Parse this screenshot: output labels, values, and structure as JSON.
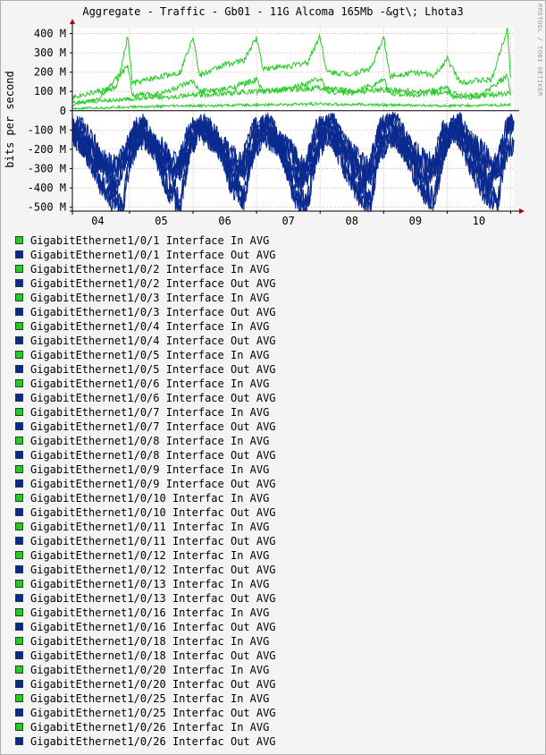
{
  "chart_data": {
    "type": "line",
    "title": "Aggregate - Traffic - Gb01 - 11G Alcoma 165Mb -&gt\\; Lhota3",
    "ylabel": "bits per second",
    "xlabel": "",
    "watermark": "RRDTOOL / TOBI OETIKER",
    "y_ticks": [
      "400 M",
      "300 M",
      "200 M",
      "100 M",
      "0",
      "-100 M",
      "-200 M",
      "-300 M",
      "-400 M",
      "-500 M"
    ],
    "y_tick_values": [
      400,
      300,
      200,
      100,
      0,
      -100,
      -200,
      -300,
      -400,
      -500
    ],
    "ylim": [
      -520,
      430
    ],
    "x_ticks": [
      "04",
      "05",
      "06",
      "07",
      "08",
      "09",
      "10"
    ],
    "x_range_days": [
      3.6,
      10.55
    ],
    "grid": true,
    "colors": {
      "in": "#22cc22",
      "out": "#0b2a8f",
      "axis": "#000000",
      "grid": "#e08080",
      "arrow": "#aa0000"
    },
    "series": [
      {
        "name": "GigabitEthernet1/0/1 Interface In AVG",
        "kind": "in"
      },
      {
        "name": "GigabitEthernet1/0/1 Interface Out AVG",
        "kind": "out"
      },
      {
        "name": "GigabitEthernet1/0/2 Interface In AVG",
        "kind": "in"
      },
      {
        "name": "GigabitEthernet1/0/2 Interface Out AVG",
        "kind": "out"
      },
      {
        "name": "GigabitEthernet1/0/3 Interface In AVG",
        "kind": "in"
      },
      {
        "name": "GigabitEthernet1/0/3 Interface Out AVG",
        "kind": "out"
      },
      {
        "name": "GigabitEthernet1/0/4 Interface In AVG",
        "kind": "in"
      },
      {
        "name": "GigabitEthernet1/0/4 Interface Out AVG",
        "kind": "out"
      },
      {
        "name": "GigabitEthernet1/0/5 Interface In AVG",
        "kind": "in"
      },
      {
        "name": "GigabitEthernet1/0/5 Interface Out AVG",
        "kind": "out"
      },
      {
        "name": "GigabitEthernet1/0/6 Interface In AVG",
        "kind": "in"
      },
      {
        "name": "GigabitEthernet1/0/6 Interface Out AVG",
        "kind": "out"
      },
      {
        "name": "GigabitEthernet1/0/7 Interface In AVG",
        "kind": "in"
      },
      {
        "name": "GigabitEthernet1/0/7 Interface Out AVG",
        "kind": "out"
      },
      {
        "name": "GigabitEthernet1/0/8 Interface In AVG",
        "kind": "in"
      },
      {
        "name": "GigabitEthernet1/0/8 Interface Out AVG",
        "kind": "out"
      },
      {
        "name": "GigabitEthernet1/0/9 Interface In AVG",
        "kind": "in"
      },
      {
        "name": "GigabitEthernet1/0/9 Interface Out AVG",
        "kind": "out"
      },
      {
        "name": "GigabitEthernet1/0/10 Interfac In AVG",
        "kind": "in"
      },
      {
        "name": "GigabitEthernet1/0/10 Interfac Out AVG",
        "kind": "out"
      },
      {
        "name": "GigabitEthernet1/0/11 Interfac In AVG",
        "kind": "in"
      },
      {
        "name": "GigabitEthernet1/0/11 Interfac Out AVG",
        "kind": "out"
      },
      {
        "name": "GigabitEthernet1/0/12 Interfac In AVG",
        "kind": "in"
      },
      {
        "name": "GigabitEthernet1/0/12 Interfac Out AVG",
        "kind": "out"
      },
      {
        "name": "GigabitEthernet1/0/13 Interfac In AVG",
        "kind": "in"
      },
      {
        "name": "GigabitEthernet1/0/13 Interfac Out AVG",
        "kind": "out"
      },
      {
        "name": "GigabitEthernet1/0/16 Interfac In AVG",
        "kind": "in"
      },
      {
        "name": "GigabitEthernet1/0/16 Interfac Out AVG",
        "kind": "out"
      },
      {
        "name": "GigabitEthernet1/0/18 Interfac In AVG",
        "kind": "in"
      },
      {
        "name": "GigabitEthernet1/0/18 Interfac Out AVG",
        "kind": "out"
      },
      {
        "name": "GigabitEthernet1/0/20 Interfac In AVG",
        "kind": "in"
      },
      {
        "name": "GigabitEthernet1/0/20 Interfac Out AVG",
        "kind": "out"
      },
      {
        "name": "GigabitEthernet1/0/25 Interfac In AVG",
        "kind": "in"
      },
      {
        "name": "GigabitEthernet1/0/25 Interfac Out AVG",
        "kind": "out"
      },
      {
        "name": "GigabitEthernet1/0/26 Interfac In AVG",
        "kind": "in"
      },
      {
        "name": "GigabitEthernet1/0/26 Interfac Out AVG",
        "kind": "out"
      }
    ],
    "traces": {
      "in": [
        [
          [
            3.6,
            70
          ],
          [
            4.0,
            100
          ],
          [
            4.3,
            120
          ],
          [
            4.47,
            380
          ],
          [
            4.55,
            140
          ],
          [
            4.9,
            170
          ],
          [
            5.3,
            200
          ],
          [
            5.5,
            390
          ],
          [
            5.6,
            180
          ],
          [
            6.0,
            240
          ],
          [
            6.3,
            260
          ],
          [
            6.5,
            380
          ],
          [
            6.6,
            220
          ],
          [
            7.0,
            230
          ],
          [
            7.3,
            250
          ],
          [
            7.5,
            390
          ],
          [
            7.6,
            200
          ],
          [
            8.0,
            190
          ],
          [
            8.3,
            220
          ],
          [
            8.5,
            380
          ],
          [
            8.6,
            180
          ],
          [
            9.0,
            200
          ],
          [
            9.3,
            180
          ],
          [
            9.5,
            270
          ],
          [
            9.7,
            150
          ],
          [
            10.2,
            160
          ],
          [
            10.45,
            430
          ],
          [
            10.5,
            170
          ]
        ],
        [
          [
            3.6,
            30
          ],
          [
            4.0,
            60
          ],
          [
            4.47,
            230
          ],
          [
            4.55,
            80
          ],
          [
            5.0,
            90
          ],
          [
            5.5,
            150
          ],
          [
            5.6,
            100
          ],
          [
            6.0,
            110
          ],
          [
            6.5,
            160
          ],
          [
            6.6,
            100
          ],
          [
            7.0,
            110
          ],
          [
            7.5,
            170
          ],
          [
            7.6,
            100
          ],
          [
            8.0,
            90
          ],
          [
            8.5,
            160
          ],
          [
            8.6,
            90
          ],
          [
            9.0,
            80
          ],
          [
            9.5,
            120
          ],
          [
            9.6,
            70
          ],
          [
            10.0,
            70
          ],
          [
            10.45,
            180
          ],
          [
            10.5,
            80
          ]
        ],
        [
          [
            3.6,
            40
          ],
          [
            4.0,
            50
          ],
          [
            4.5,
            60
          ],
          [
            5.0,
            70
          ],
          [
            5.5,
            80
          ],
          [
            6.0,
            90
          ],
          [
            6.5,
            100
          ],
          [
            7.0,
            110
          ],
          [
            7.5,
            120
          ],
          [
            8.0,
            100
          ],
          [
            8.5,
            110
          ],
          [
            9.0,
            100
          ],
          [
            9.5,
            90
          ],
          [
            10.0,
            80
          ],
          [
            10.5,
            90
          ]
        ],
        [
          [
            3.6,
            10
          ],
          [
            4.5,
            20
          ],
          [
            5.5,
            25
          ],
          [
            6.5,
            30
          ],
          [
            7.5,
            35
          ],
          [
            8.5,
            30
          ],
          [
            9.5,
            25
          ],
          [
            10.5,
            30
          ]
        ]
      ],
      "out": [
        [
          [
            3.6,
            -100
          ],
          [
            3.8,
            -200
          ],
          [
            4.0,
            -350
          ],
          [
            4.2,
            -450
          ],
          [
            4.4,
            -500
          ],
          [
            4.5,
            -250
          ],
          [
            4.7,
            -100
          ],
          [
            4.9,
            -200
          ],
          [
            5.1,
            -400
          ],
          [
            5.3,
            -480
          ],
          [
            5.45,
            -200
          ],
          [
            5.6,
            -80
          ],
          [
            5.9,
            -150
          ],
          [
            6.1,
            -380
          ],
          [
            6.3,
            -450
          ],
          [
            6.45,
            -200
          ],
          [
            6.6,
            -60
          ],
          [
            6.9,
            -200
          ],
          [
            7.1,
            -450
          ],
          [
            7.3,
            -480
          ],
          [
            7.45,
            -200
          ],
          [
            7.6,
            -60
          ],
          [
            7.9,
            -300
          ],
          [
            8.1,
            -420
          ],
          [
            8.3,
            -480
          ],
          [
            8.45,
            -150
          ],
          [
            8.6,
            -50
          ],
          [
            8.9,
            -250
          ],
          [
            9.1,
            -400
          ],
          [
            9.3,
            -470
          ],
          [
            9.45,
            -200
          ],
          [
            9.6,
            -60
          ],
          [
            9.9,
            -300
          ],
          [
            10.1,
            -420
          ],
          [
            10.3,
            -480
          ],
          [
            10.45,
            -100
          ],
          [
            10.55,
            -60
          ]
        ],
        [
          [
            3.6,
            -60
          ],
          [
            3.9,
            -150
          ],
          [
            4.1,
            -300
          ],
          [
            4.3,
            -400
          ],
          [
            4.5,
            -150
          ],
          [
            4.7,
            -60
          ],
          [
            5.0,
            -250
          ],
          [
            5.2,
            -350
          ],
          [
            5.45,
            -100
          ],
          [
            5.7,
            -60
          ],
          [
            6.0,
            -250
          ],
          [
            6.2,
            -350
          ],
          [
            6.45,
            -100
          ],
          [
            6.7,
            -50
          ],
          [
            7.0,
            -300
          ],
          [
            7.2,
            -380
          ],
          [
            7.45,
            -100
          ],
          [
            7.7,
            -50
          ],
          [
            8.0,
            -280
          ],
          [
            8.2,
            -380
          ],
          [
            8.45,
            -80
          ],
          [
            8.7,
            -40
          ],
          [
            9.0,
            -260
          ],
          [
            9.2,
            -360
          ],
          [
            9.45,
            -100
          ],
          [
            9.7,
            -50
          ],
          [
            10.0,
            -280
          ],
          [
            10.2,
            -380
          ],
          [
            10.45,
            -80
          ],
          [
            10.55,
            -50
          ]
        ],
        [
          [
            3.6,
            -120
          ],
          [
            4.0,
            -250
          ],
          [
            4.3,
            -300
          ],
          [
            4.6,
            -120
          ],
          [
            5.0,
            -200
          ],
          [
            5.3,
            -300
          ],
          [
            5.6,
            -100
          ],
          [
            6.0,
            -200
          ],
          [
            6.3,
            -300
          ],
          [
            6.6,
            -120
          ],
          [
            7.0,
            -200
          ],
          [
            7.3,
            -320
          ],
          [
            7.6,
            -120
          ],
          [
            8.0,
            -220
          ],
          [
            8.3,
            -320
          ],
          [
            8.6,
            -120
          ],
          [
            9.0,
            -220
          ],
          [
            9.3,
            -300
          ],
          [
            9.6,
            -100
          ],
          [
            10.0,
            -200
          ],
          [
            10.3,
            -300
          ],
          [
            10.55,
            -150
          ]
        ]
      ]
    }
  },
  "legend_swatch_colors": {
    "in": "#22cc22",
    "out": "#0b2a8f"
  }
}
